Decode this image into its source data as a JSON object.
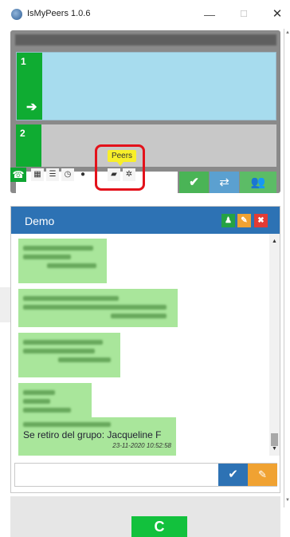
{
  "window": {
    "title": "IsMyPeers 1.0.6",
    "minimize_glyph": "—",
    "maximize_glyph": "☐",
    "close_glyph": "✕"
  },
  "lines": [
    {
      "number": "1",
      "arrow_glyph": "➔",
      "status": "active"
    },
    {
      "number": "2",
      "status": "idle"
    }
  ],
  "dialer": {
    "call_glyph": "✔",
    "transfer_glyph": "⇄",
    "conference_icon": "users-icon",
    "conference_glyph": "👥"
  },
  "toolbar": {
    "tools": [
      {
        "name": "phone",
        "glyph": "☎"
      },
      {
        "name": "grid",
        "glyph": "▦"
      },
      {
        "name": "list",
        "glyph": "☰"
      },
      {
        "name": "history",
        "glyph": "◷"
      },
      {
        "name": "record",
        "glyph": "●"
      },
      {
        "name": "peers",
        "glyph": "▰"
      },
      {
        "name": "settings",
        "glyph": "✲"
      }
    ],
    "tooltip": "Peers"
  },
  "chat": {
    "title": "Demo",
    "header_buttons": {
      "user_glyph": "♟",
      "edit_glyph": "✎",
      "close_glyph": "✖"
    },
    "last_message": {
      "text": "Se retiro del grupo: Jacqueline F",
      "time": "23-11-2020 10:52:58"
    },
    "scroll_up_glyph": "▲",
    "scroll_down_glyph": "▼",
    "send_glyph": "✔",
    "clear_glyph": "✎"
  },
  "footer": {
    "refresh_glyph": "C"
  },
  "colors": {
    "green": "#0fac32",
    "blue": "#2d72b4",
    "orange": "#f0a232",
    "red": "#e33b34",
    "message_bg": "#a9e69b",
    "highlight": "#e3121b",
    "tooltip_bg": "#f8ef2a"
  }
}
